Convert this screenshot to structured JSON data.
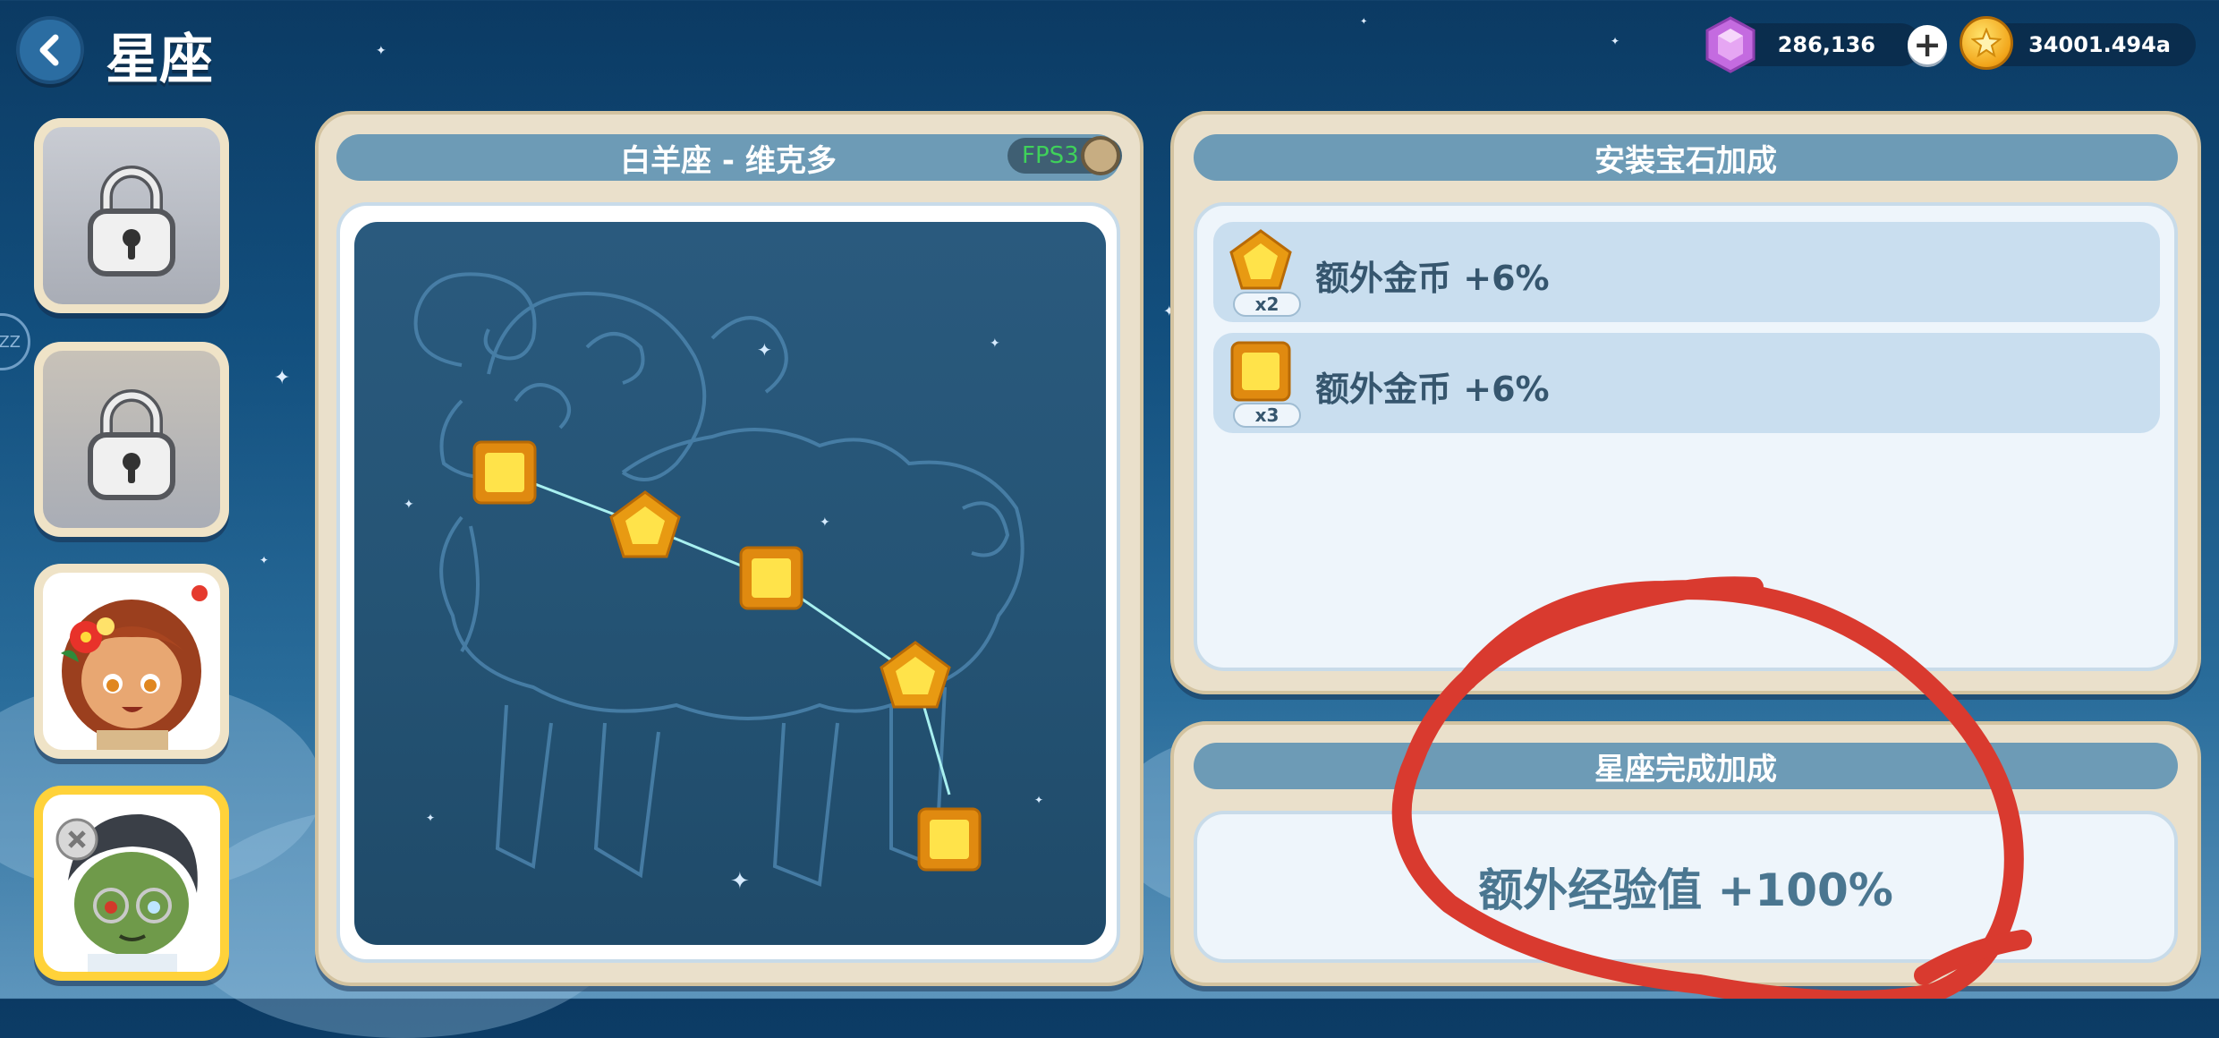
{
  "header": {
    "title": "星座",
    "gems": "286,136",
    "coins": "34001.494a"
  },
  "fps_label": "FPS3",
  "side_handle_label": "ZZ",
  "constellation": {
    "title": "白羊座 - 维克多",
    "gems": [
      "square",
      "pentagon",
      "square",
      "pentagon",
      "square"
    ]
  },
  "install_bonus": {
    "title": "安装宝石加成",
    "rows": [
      {
        "gem": "pentagon",
        "count": "x2",
        "text": "额外金币 +6%"
      },
      {
        "gem": "square",
        "count": "x3",
        "text": "额外金币 +6%"
      }
    ]
  },
  "completion_bonus": {
    "title": "星座完成加成",
    "text": "额外经验值 +100%"
  },
  "portraits": [
    {
      "state": "locked"
    },
    {
      "state": "locked"
    },
    {
      "state": "unlocked",
      "notification": true
    },
    {
      "state": "selected"
    }
  ],
  "colors": {
    "annotation": "#d93a2f",
    "constellation_line": "#a8f0f0",
    "gem_gold": "#f5c21a"
  }
}
